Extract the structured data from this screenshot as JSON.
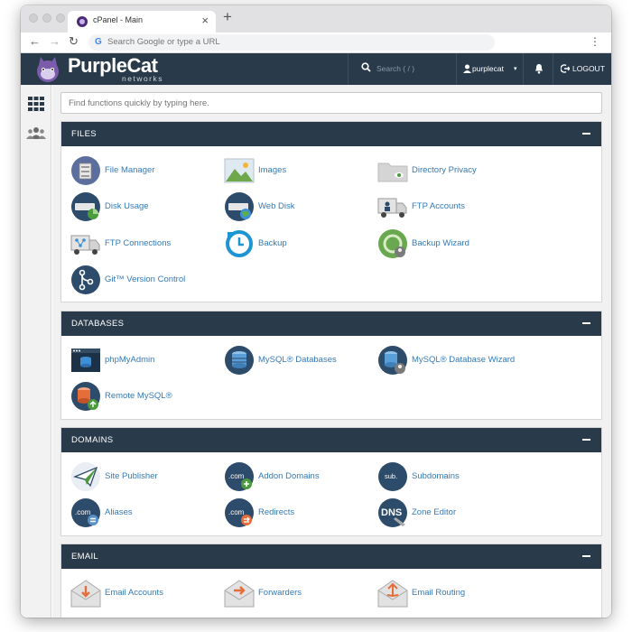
{
  "browser": {
    "tab_title": "cPanel - Main",
    "tab_close": "×",
    "new_tab": "+",
    "back": "←",
    "forward": "→",
    "reload": "↻",
    "omnibox_g": "G",
    "omnibox_placeholder": "Search Google or type a URL",
    "menu": "⋮"
  },
  "header": {
    "logo_name": "PurpleCat",
    "logo_sub": "networks",
    "search_placeholder": "Search ( / )",
    "username": "purplecat",
    "caret": "▾",
    "logout": "LOGOUT"
  },
  "quick_search": {
    "placeholder": "Find functions quickly by typing here."
  },
  "sections": [
    {
      "title": "FILES",
      "items": [
        {
          "label": "File Manager",
          "icon": "file-manager-icon"
        },
        {
          "label": "Images",
          "icon": "images-icon"
        },
        {
          "label": "Directory Privacy",
          "icon": "directory-privacy-icon"
        },
        {
          "label": "Disk Usage",
          "icon": "disk-usage-icon"
        },
        {
          "label": "Web Disk",
          "icon": "web-disk-icon"
        },
        {
          "label": "FTP Accounts",
          "icon": "ftp-accounts-icon"
        },
        {
          "label": "FTP Connections",
          "icon": "ftp-connections-icon"
        },
        {
          "label": "Backup",
          "icon": "backup-icon"
        },
        {
          "label": "Backup Wizard",
          "icon": "backup-wizard-icon"
        },
        {
          "label": "Git™ Version Control",
          "icon": "git-icon"
        }
      ]
    },
    {
      "title": "DATABASES",
      "items": [
        {
          "label": "phpMyAdmin",
          "icon": "phpmyadmin-icon"
        },
        {
          "label": "MySQL® Databases",
          "icon": "mysql-databases-icon"
        },
        {
          "label": "MySQL® Database Wizard",
          "icon": "mysql-wizard-icon"
        },
        {
          "label": "Remote MySQL®",
          "icon": "remote-mysql-icon"
        }
      ]
    },
    {
      "title": "DOMAINS",
      "items": [
        {
          "label": "Site Publisher",
          "icon": "site-publisher-icon"
        },
        {
          "label": "Addon Domains",
          "icon": "addon-domains-icon",
          "badge": ".com"
        },
        {
          "label": "Subdomains",
          "icon": "subdomains-icon",
          "badge": "sub."
        },
        {
          "label": "Aliases",
          "icon": "aliases-icon",
          "badge": ".com"
        },
        {
          "label": "Redirects",
          "icon": "redirects-icon",
          "badge": ".com"
        },
        {
          "label": "Zone Editor",
          "icon": "zone-editor-icon",
          "badge": "DNS"
        }
      ]
    },
    {
      "title": "EMAIL",
      "items": [
        {
          "label": "Email Accounts",
          "icon": "email-accounts-icon"
        },
        {
          "label": "Forwarders",
          "icon": "forwarders-icon"
        },
        {
          "label": "Email Routing",
          "icon": "email-routing-icon"
        }
      ]
    }
  ],
  "colors": {
    "header": "#293a4a",
    "link": "#337ab7",
    "accent": "#7a5cab"
  }
}
